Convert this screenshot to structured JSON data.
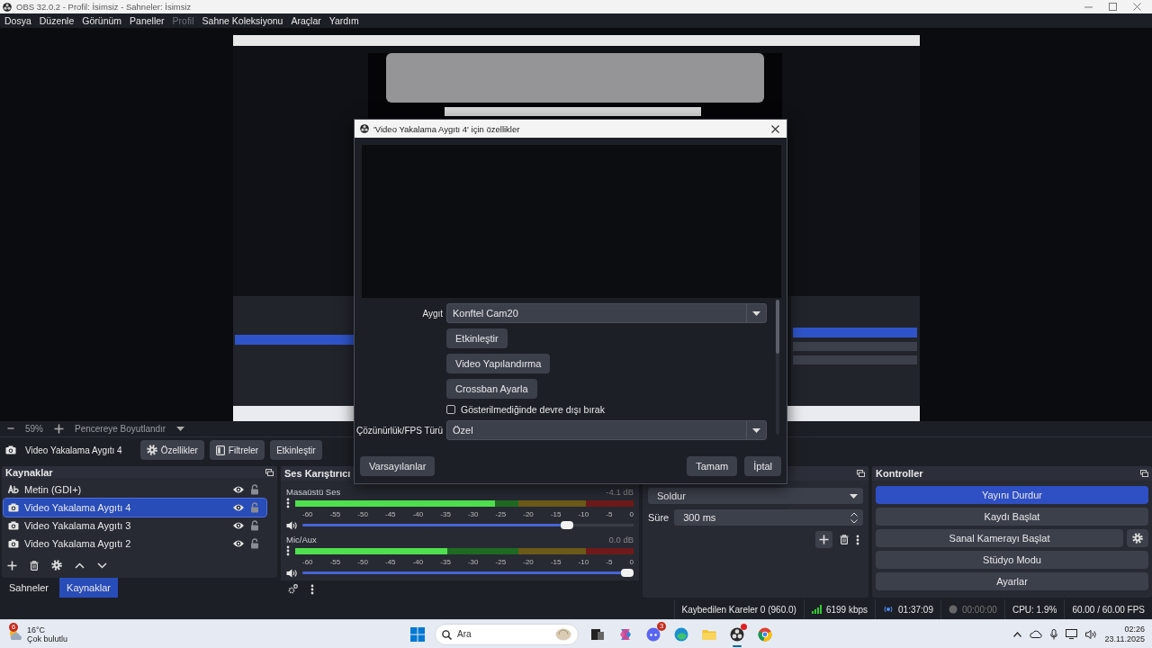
{
  "window": {
    "title": "OBS 32.0.2 - Profil: İsimsiz - Sahneler: İsimsiz"
  },
  "menu": [
    {
      "label": "Dosya",
      "disabled": false
    },
    {
      "label": "Düzenle",
      "disabled": false
    },
    {
      "label": "Görünüm",
      "disabled": false
    },
    {
      "label": "Paneller",
      "disabled": false
    },
    {
      "label": "Profil",
      "disabled": true
    },
    {
      "label": "Sahne Koleksiyonu",
      "disabled": false
    },
    {
      "label": "Araçlar",
      "disabled": false
    },
    {
      "label": "Yardım",
      "disabled": false
    }
  ],
  "zoom": {
    "value": "59%",
    "mode": "Pencereye Boyutlandır"
  },
  "source_toolbar": {
    "source": "Video Yakalama Aygıtı 4",
    "buttons": [
      {
        "label": "Özellikler",
        "kind": "gear"
      },
      {
        "label": "Filtreler",
        "kind": "filter"
      },
      {
        "label": "Etkinleştir",
        "kind": "plain"
      }
    ]
  },
  "sources": {
    "title": "Kaynaklar",
    "items": [
      {
        "name": "Metin (GDI+)",
        "kind": "text",
        "selected": false,
        "visible": true,
        "locked": false
      },
      {
        "name": "Video Yakalama Aygıtı 4",
        "kind": "camera",
        "selected": true,
        "visible": true,
        "locked": false
      },
      {
        "name": "Video Yakalama Aygıtı 3",
        "kind": "camera",
        "selected": false,
        "visible": true,
        "locked": false
      },
      {
        "name": "Video Yakalama Aygıtı 2",
        "kind": "camera",
        "selected": false,
        "visible": true,
        "locked": false
      }
    ]
  },
  "dock_tabs": [
    {
      "label": "Sahneler",
      "selected": false
    },
    {
      "label": "Kaynaklar",
      "selected": true
    }
  ],
  "mixer": {
    "title": "Ses Karıştırıcı",
    "channels": [
      {
        "name": "Masaüstü Ses",
        "reading": "-4.1 dB",
        "meter": {
          "level": 0.59
        },
        "fader": {
          "level": 0.81
        },
        "muted": false,
        "scale": [
          "-60",
          "-55",
          "-50",
          "-45",
          "-40",
          "-35",
          "-30",
          "-25",
          "-20",
          "-15",
          "-10",
          "-5",
          "0"
        ]
      },
      {
        "name": "Mic/Aux",
        "reading": "0.0 dB",
        "meter": {
          "level": 0.45
        },
        "fader": {
          "level": 1.0
        },
        "muted": false,
        "scale": [
          "-60",
          "-55",
          "-50",
          "-45",
          "-40",
          "-35",
          "-30",
          "-25",
          "-20",
          "-15",
          "-10",
          "-5",
          "0"
        ]
      }
    ]
  },
  "transitions": {
    "transition": "Soldur",
    "duration_label": "Süre",
    "duration": "300 ms"
  },
  "controls": {
    "title": "Kontroller",
    "buttons": [
      {
        "label": "Yayını Durdur",
        "active": true,
        "settings": false
      },
      {
        "label": "Kaydı Başlat",
        "active": false,
        "settings": false
      },
      {
        "label": "Sanal Kamerayı Başlat",
        "active": false,
        "settings": true
      },
      {
        "label": "Stüdyo Modu",
        "active": false,
        "settings": false
      },
      {
        "label": "Ayarlar",
        "active": false,
        "settings": false
      }
    ]
  },
  "status_bar": {
    "dropped": "Kaybedilen Kareler 0 (960.0)",
    "bitrate": "6199 kbps",
    "stream_time": "01:37:09",
    "record_time": "00:00:00",
    "cpu": "CPU: 1.9%",
    "fps": "60.00 / 60.00 FPS"
  },
  "dialog": {
    "title": "'Video Yakalama Aygıtı 4' için özellikler",
    "device_label": "Aygıt",
    "device": "Konftel Cam20",
    "buttons": [
      "Etkinleştir",
      "Video Yapılandırma",
      "Crossban Ayarla"
    ],
    "checkbox": {
      "label": "Gösterilmediğinde devre dışı bırak",
      "checked": false
    },
    "resolution_label": "Çözünürlük/FPS Türü",
    "resolution": "Özel",
    "footer": {
      "defaults": "Varsayılanlar",
      "ok": "Tamam",
      "cancel": "İptal"
    }
  },
  "taskbar": {
    "weather": {
      "badge": "6",
      "temperature": "16°C",
      "condition": "Çok bulutlu"
    },
    "search": {
      "placeholder": "Ara"
    },
    "apps": [
      {
        "kind": "taskview",
        "active": false,
        "notify": false
      },
      {
        "kind": "copilot",
        "active": false,
        "notify": false
      },
      {
        "kind": "chat",
        "active": false,
        "notify": false,
        "badge": "3"
      },
      {
        "kind": "browser",
        "active": false,
        "notify": false
      },
      {
        "kind": "folder",
        "active": false,
        "notify": false
      },
      {
        "kind": "obs",
        "active": true,
        "notify": true
      },
      {
        "kind": "chrome",
        "active": false,
        "notify": false
      }
    ],
    "time": "02:26",
    "date": "23.11.2025"
  }
}
